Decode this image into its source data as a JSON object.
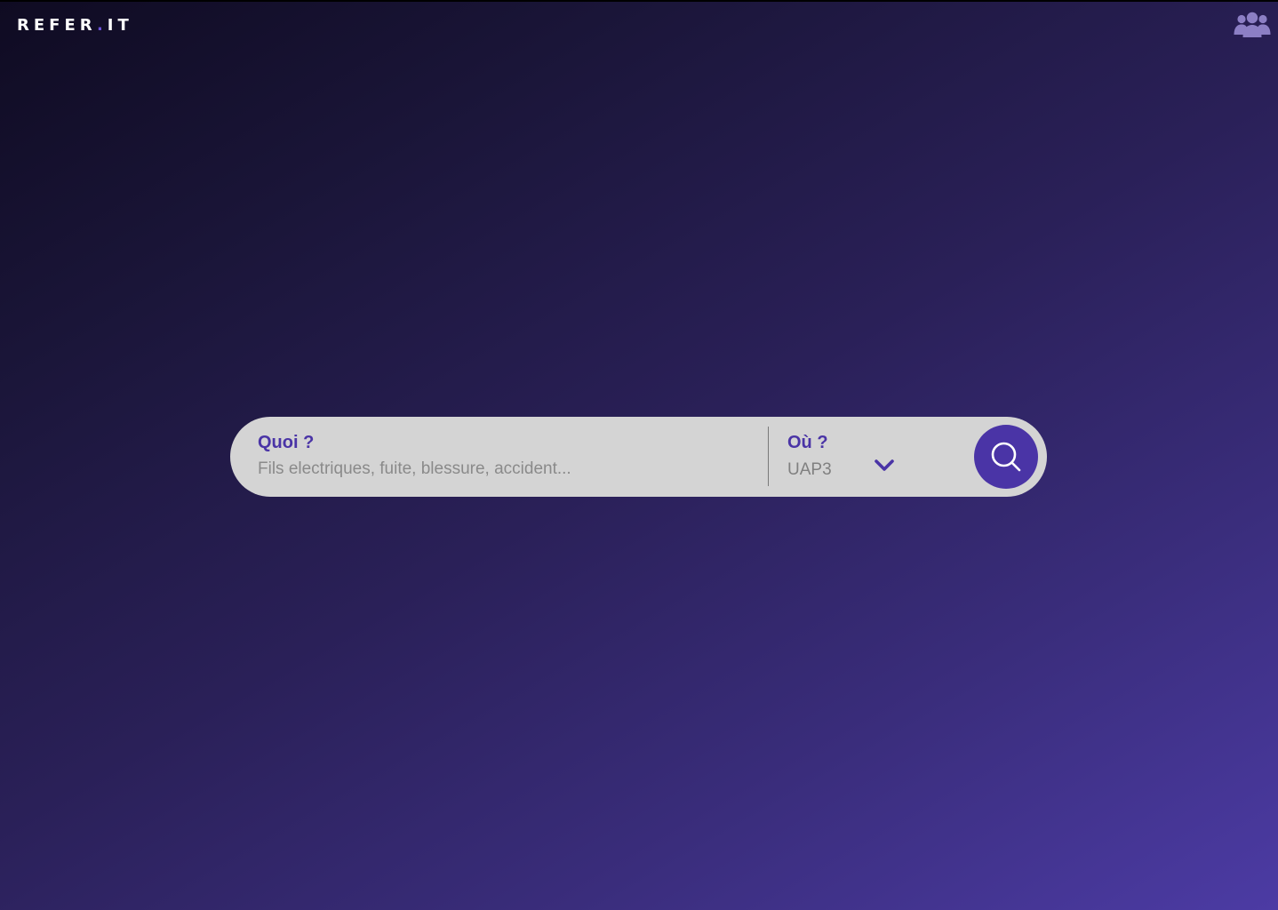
{
  "header": {
    "logo_main": "REFER",
    "logo_dot": ".",
    "logo_suffix": "IT",
    "users_icon": "users-group-icon"
  },
  "search": {
    "what_label": "Quoi ?",
    "what_placeholder": "Fils electriques, fuite, blessure, accident...",
    "where_label": "Où ?",
    "where_value": "UAP3",
    "dropdown_icon": "chevron-down-icon",
    "button_icon": "search-icon"
  },
  "colors": {
    "accent": "#4a34a6",
    "search_bar_bg": "#d4d4d4",
    "background_start": "#0f0b22",
    "background_end": "#4c3ba4",
    "logo_dot": "#6b52d9"
  }
}
